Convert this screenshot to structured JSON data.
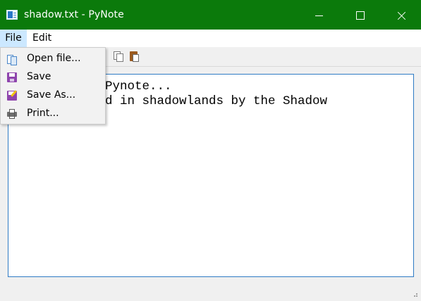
{
  "window": {
    "title": "shadow.txt - PyNote",
    "title_bar_color": "#0b7a0b",
    "buttons": [
      "minimize",
      "maximize",
      "close"
    ]
  },
  "menubar": {
    "items": [
      {
        "label": "File",
        "active": true
      },
      {
        "label": "Edit",
        "active": false
      }
    ]
  },
  "toolbar": {
    "icons": [
      "cut-icon",
      "copy-icon",
      "paste-icon"
    ]
  },
  "file_menu": {
    "items": [
      {
        "label": "Open file...",
        "icon": "open-icon"
      },
      {
        "label": "Save",
        "icon": "save-icon"
      },
      {
        "label": "Save As...",
        "icon": "save-as-icon"
      },
      {
        "label": "Print...",
        "icon": "print-icon"
      }
    ]
  },
  "editor": {
    "visible_lines": [
      "Pynote...",
      "d in shadowlands by the Shadow"
    ],
    "border_color": "#2f7bc4"
  }
}
